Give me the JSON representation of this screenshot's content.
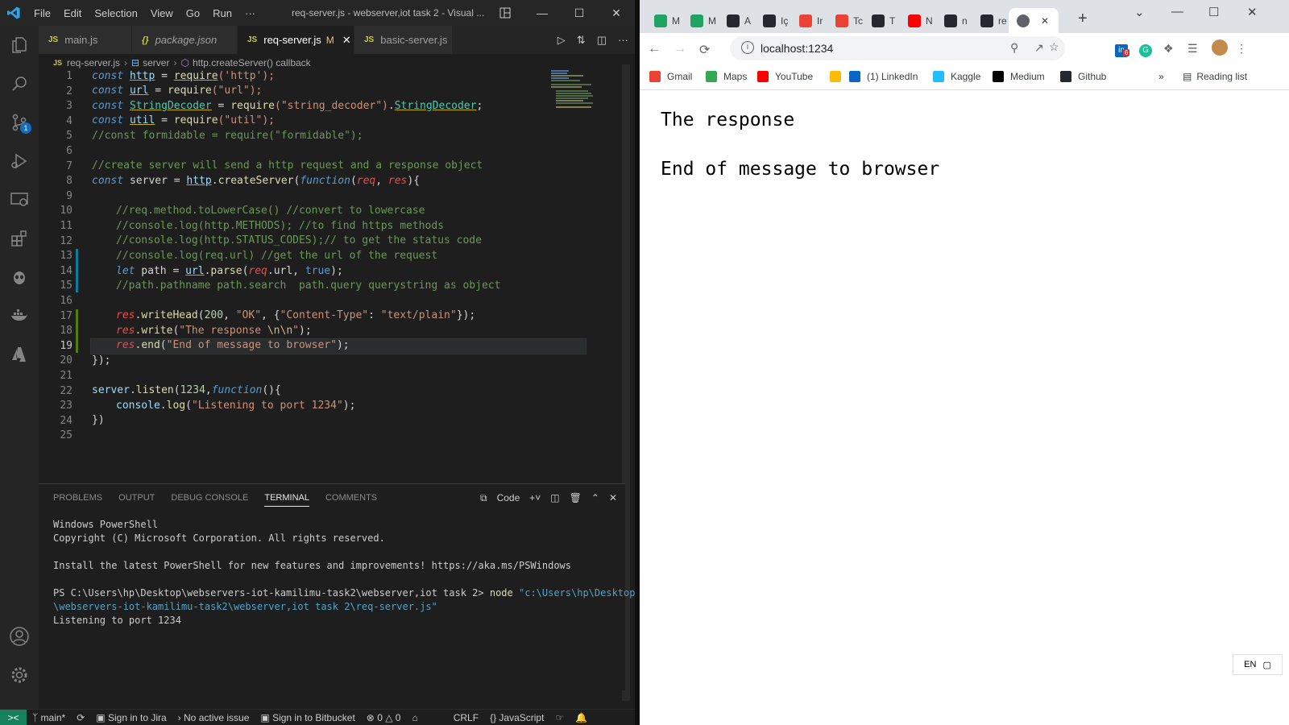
{
  "vscode": {
    "menu": [
      "File",
      "Edit",
      "Selection",
      "View",
      "Go",
      "Run",
      "···"
    ],
    "window_title": "req-server.js - webserver,iot task 2 - Visual ...",
    "tabs": [
      {
        "icon": "JS",
        "label": "main.js"
      },
      {
        "icon": "{}",
        "label": "package.json"
      },
      {
        "icon": "JS",
        "label": "req-server.js",
        "status": "M"
      },
      {
        "icon": "JS",
        "label": "basic-server.js"
      }
    ],
    "breadcrumb": {
      "file": "req-server.js",
      "symbol1": "server",
      "symbol2": "http.createServer() callback"
    },
    "source_control_badge": "1",
    "line_numbers": [
      "1",
      "2",
      "3",
      "4",
      "5",
      "6",
      "7",
      "8",
      "9",
      "10",
      "11",
      "12",
      "13",
      "14",
      "15",
      "16",
      "17",
      "18",
      "19",
      "20",
      "21",
      "22",
      "23",
      "24",
      "25"
    ],
    "code": {
      "l1": [
        "const",
        " ",
        "http",
        " = ",
        "require",
        "('http');"
      ],
      "l2": [
        "const",
        " ",
        "url",
        " = ",
        "require",
        "(\"url\");"
      ],
      "l3": [
        "const",
        " ",
        "StringDecoder",
        " = ",
        "require",
        "(\"string_decoder\")",
        ".",
        "StringDecoder",
        ";"
      ],
      "l4": [
        "const",
        " ",
        "util",
        " = ",
        "require",
        "(\"util\");"
      ],
      "l5": "//const formidable = require(\"formidable\");",
      "l7": "//create server will send a http request and a response object",
      "l8": [
        "const",
        " server = ",
        "http",
        ".",
        "createServer",
        "(",
        "function",
        "(",
        "req",
        ", ",
        "res",
        "){"
      ],
      "l10": "//req.method.toLowerCase() //convert to lowercase",
      "l11": "//console.log(http.METHODS); //to find https methods",
      "l12": "//console.log(http.STATUS_CODES);// to get the status code",
      "l13": "//console.log(req.url) //get the url of the request",
      "l14": [
        "let",
        " path = ",
        "url",
        ".",
        "parse",
        "(",
        "req",
        ".url, ",
        "true",
        ");"
      ],
      "l15": "//path.pathname path.search  path.query querystring as object",
      "l17": [
        "res",
        ".",
        "writeHead",
        "(",
        "200",
        ", ",
        "\"OK\"",
        ", {",
        "\"Content-Type\"",
        ": ",
        "\"text/plain\"",
        "});"
      ],
      "l18": [
        "res",
        ".",
        "write",
        "(",
        "\"The response ",
        "\\n\\n",
        "\"",
        ");"
      ],
      "l19": [
        "res",
        ".",
        "end",
        "(",
        "\"End of message to browser\"",
        ");"
      ],
      "l20": "});",
      "l22": [
        "server",
        ".",
        "listen",
        "(",
        "1234",
        ",",
        "function",
        "(){"
      ],
      "l23": [
        "console",
        ".",
        "log",
        "(",
        "\"Listening to port 1234\"",
        ");"
      ],
      "l24": "})"
    },
    "panel": {
      "tabs": [
        "PROBLEMS",
        "OUTPUT",
        "DEBUG CONSOLE",
        "TERMINAL",
        "COMMENTS"
      ],
      "active_tab": "TERMINAL",
      "terminal_name": "Code",
      "terminal": {
        "line1": "Windows PowerShell",
        "line2": "Copyright (C) Microsoft Corporation. All rights reserved.",
        "line3": "Install the latest PowerShell for new features and improvements! https://aka.ms/PSWindows",
        "prompt": "PS C:\\Users\\hp\\Desktop\\webservers-iot-kamilimu-task2\\webserver,iot task 2> ",
        "command": "node",
        "arg1": " \"c:\\Users\\hp\\Desktop",
        "arg2": "\\webservers-iot-kamilimu-task2\\webserver,iot task 2\\req-server.js\"",
        "output": "Listening to port 1234"
      }
    },
    "statusbar": {
      "branch": "main*",
      "jira": "Sign in to Jira",
      "issue": "No active issue",
      "bitbucket": "Sign in to Bitbucket",
      "errors": "0",
      "warnings": "0",
      "eol": "CRLF",
      "language": "JavaScript"
    }
  },
  "chrome": {
    "tabs": [
      {
        "icon": "google-drive-icon",
        "label": "M",
        "color": "#1fa463"
      },
      {
        "icon": "google-drive-icon",
        "label": "M",
        "color": "#1fa463"
      },
      {
        "icon": "github-icon",
        "label": "A",
        "color": "#24292f"
      },
      {
        "icon": "github-icon",
        "label": "Iç",
        "color": "#24292f"
      },
      {
        "icon": "gmail-icon",
        "label": "Ir",
        "color": "#ea4335"
      },
      {
        "icon": "gmail-icon",
        "label": "Tc",
        "color": "#ea4335"
      },
      {
        "icon": "github-icon",
        "label": "T",
        "color": "#24292f"
      },
      {
        "icon": "youtube-icon",
        "label": "N",
        "color": "#ff0000"
      },
      {
        "icon": "github-icon",
        "label": "n",
        "color": "#24292f"
      },
      {
        "icon": "github-icon",
        "label": "re",
        "color": "#24292f"
      },
      {
        "icon": "globe-icon",
        "label": "",
        "color": "#5f6368",
        "active": true
      }
    ],
    "url": "localhost:1234",
    "extension_badge": "6",
    "bookmarks": [
      {
        "label": "Gmail",
        "color": "#ea4335"
      },
      {
        "label": "Maps",
        "color": "#34a853"
      },
      {
        "label": "YouTube",
        "color": "#ff0000"
      },
      {
        "label": "",
        "color": "#fbbc04"
      },
      {
        "label": "(1) LinkedIn",
        "color": "#0a66c2"
      },
      {
        "label": "Kaggle",
        "color": "#20beff"
      },
      {
        "label": "Medium",
        "color": "#000000"
      },
      {
        "label": "Github",
        "color": "#24292f"
      }
    ],
    "overflow": "»",
    "reading_list": "Reading list",
    "page": {
      "line1": "The response",
      "line2": "End of message to browser"
    },
    "ime_label": "EN"
  },
  "colors": {
    "remote_indicator": "#16825d",
    "accent": "#0e70c0"
  }
}
